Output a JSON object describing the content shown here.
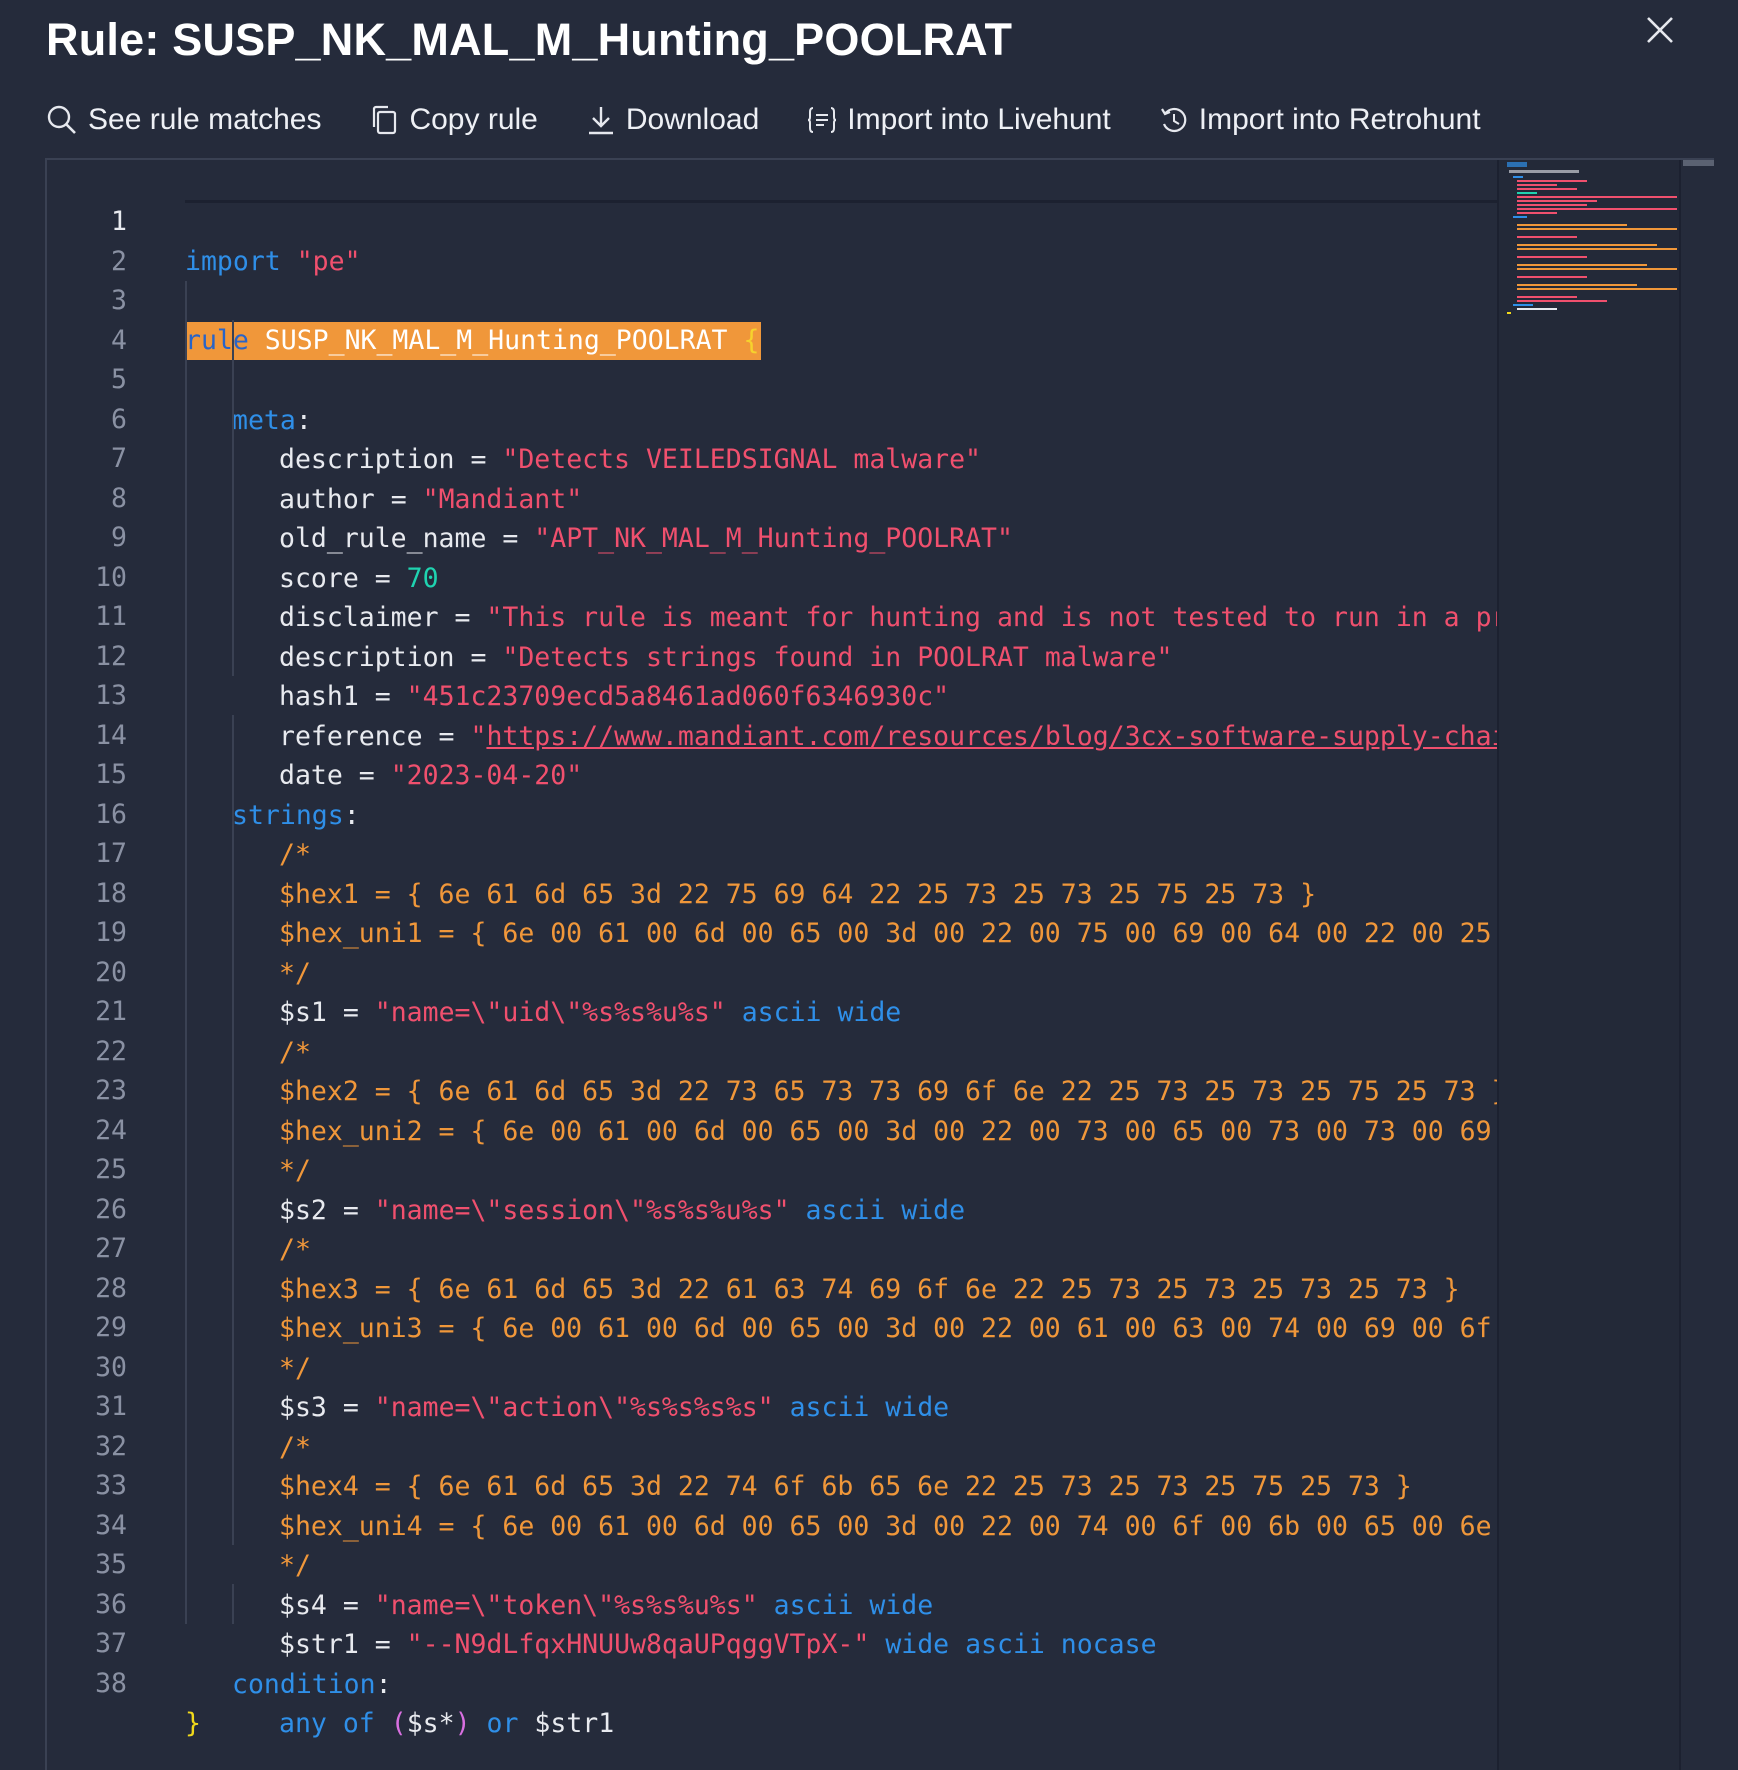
{
  "dialog": {
    "title": "Rule: SUSP_NK_MAL_M_Hunting_POOLRAT"
  },
  "toolbar": {
    "see_matches": "See rule matches",
    "copy_rule": "Copy rule",
    "download": "Download",
    "import_livehunt": "Import into Livehunt",
    "import_retrohunt": "Import into Retrohunt"
  },
  "colors": {
    "background": "#252b3b",
    "keyword": "#2f8fe8",
    "string": "#f0506e",
    "number": "#1fd3b0",
    "hex_comment": "#f0973a",
    "highlight": "#f0973a"
  },
  "code": {
    "line_numbers": [
      "1",
      "2",
      "3",
      "4",
      "5",
      "6",
      "7",
      "8",
      "9",
      "10",
      "11",
      "12",
      "13",
      "14",
      "15",
      "16",
      "17",
      "18",
      "19",
      "20",
      "21",
      "22",
      "23",
      "24",
      "25",
      "26",
      "27",
      "28",
      "29",
      "30",
      "31",
      "32",
      "33",
      "34",
      "35",
      "36",
      "37",
      "38"
    ],
    "import_kw": "import",
    "import_val": "\"pe\"",
    "rule_kw": "rule",
    "rule_name": "SUSP_NK_MAL_M_Hunting_POOLRAT",
    "open_brace": "{",
    "close_brace": "}",
    "meta_kw": "meta",
    "strings_kw": "strings",
    "condition_kw": "condition",
    "colon": ":",
    "eq": " = ",
    "meta": [
      {
        "key": "description",
        "value": "\"Detects VEILEDSIGNAL malware\""
      },
      {
        "key": "author",
        "value": "\"Mandiant\""
      },
      {
        "key": "old_rule_name",
        "value": "\"APT_NK_MAL_M_Hunting_POOLRAT\""
      },
      {
        "key": "score",
        "value": "70"
      },
      {
        "key": "disclaimer",
        "value": "\"This rule is meant for hunting and is not tested to run in a pr"
      },
      {
        "key": "description",
        "value": "\"Detects strings found in POOLRAT malware\""
      },
      {
        "key": "hash1",
        "value": "\"451c23709ecd5a8461ad060f6346930c\""
      },
      {
        "key": "reference",
        "value_q": "\"",
        "value_link": "https://www.mandiant.com/resources/blog/3cx-software-supply-chai"
      },
      {
        "key": "date",
        "value": "\"2023-04-20\""
      }
    ],
    "comment_open": "/*",
    "comment_close": "*/",
    "hex1": "$hex1 = { 6e 61 6d 65 3d 22 75 69 64 22 25 73 25 73 25 75 25 73 }",
    "hex_uni1": "$hex_uni1 = { 6e 00 61 00 6d 00 65 00 3d 00 22 00 75 00 69 00 64 00 22 00 25",
    "s1_name": "$s1",
    "s1_val": "\"name=\\\"uid\\\"%s%s%u%s\"",
    "s1_mods": "ascii wide",
    "hex2": "$hex2 = { 6e 61 6d 65 3d 22 73 65 73 73 69 6f 6e 22 25 73 25 73 25 75 25 73 }",
    "hex_uni2": "$hex_uni2 = { 6e 00 61 00 6d 00 65 00 3d 00 22 00 73 00 65 00 73 00 73 00 69",
    "s2_name": "$s2",
    "s2_val": "\"name=\\\"session\\\"%s%s%u%s\"",
    "s2_mods": "ascii wide",
    "hex3": "$hex3 = { 6e 61 6d 65 3d 22 61 63 74 69 6f 6e 22 25 73 25 73 25 73 25 73 }",
    "hex_uni3": "$hex_uni3 = { 6e 00 61 00 6d 00 65 00 3d 00 22 00 61 00 63 00 74 00 69 00 6f",
    "s3_name": "$s3",
    "s3_val": "\"name=\\\"action\\\"%s%s%s%s\"",
    "s3_mods": "ascii wide",
    "hex4": "$hex4 = { 6e 61 6d 65 3d 22 74 6f 6b 65 6e 22 25 73 25 73 25 75 25 73 }",
    "hex_uni4": "$hex_uni4 = { 6e 00 61 00 6d 00 65 00 3d 00 22 00 74 00 6f 00 6b 00 65 00 6e",
    "s4_name": "$s4",
    "s4_val": "\"name=\\\"token\\\"%s%s%u%s\"",
    "s4_mods": "ascii wide",
    "str1_name": "$str1",
    "str1_val": "\"--N9dLfqxHNUUw8qaUPqggVTpX-\"",
    "str1_mods": "wide ascii nocase",
    "cond_any": "any",
    "cond_of": "of",
    "cond_paren_open": "(",
    "cond_set": "$s*",
    "cond_paren_close": ")",
    "cond_or": "or",
    "cond_str1": "$str1"
  }
}
